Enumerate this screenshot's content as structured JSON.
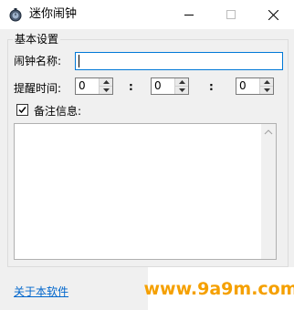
{
  "window": {
    "title": "迷你闹钟",
    "icons": {
      "app": "alarm-app-icon",
      "minimize": "minimize-icon",
      "maximize": "maximize-icon",
      "close": "close-icon"
    }
  },
  "settings": {
    "group_title": "基本设置",
    "name_label": "闹钟名称:",
    "name_value": "",
    "time_label": "提醒时间:",
    "hour": "0",
    "minute": "0",
    "second": "0",
    "colon": ":",
    "note_label": "备注信息:",
    "note_checked": true,
    "note_value": ""
  },
  "footer": {
    "about_link": "关于本软件"
  },
  "watermark": "www.9a9m.com",
  "colors": {
    "accent": "#0078d7",
    "link": "#0066cc",
    "watermark": "#f5a000"
  }
}
